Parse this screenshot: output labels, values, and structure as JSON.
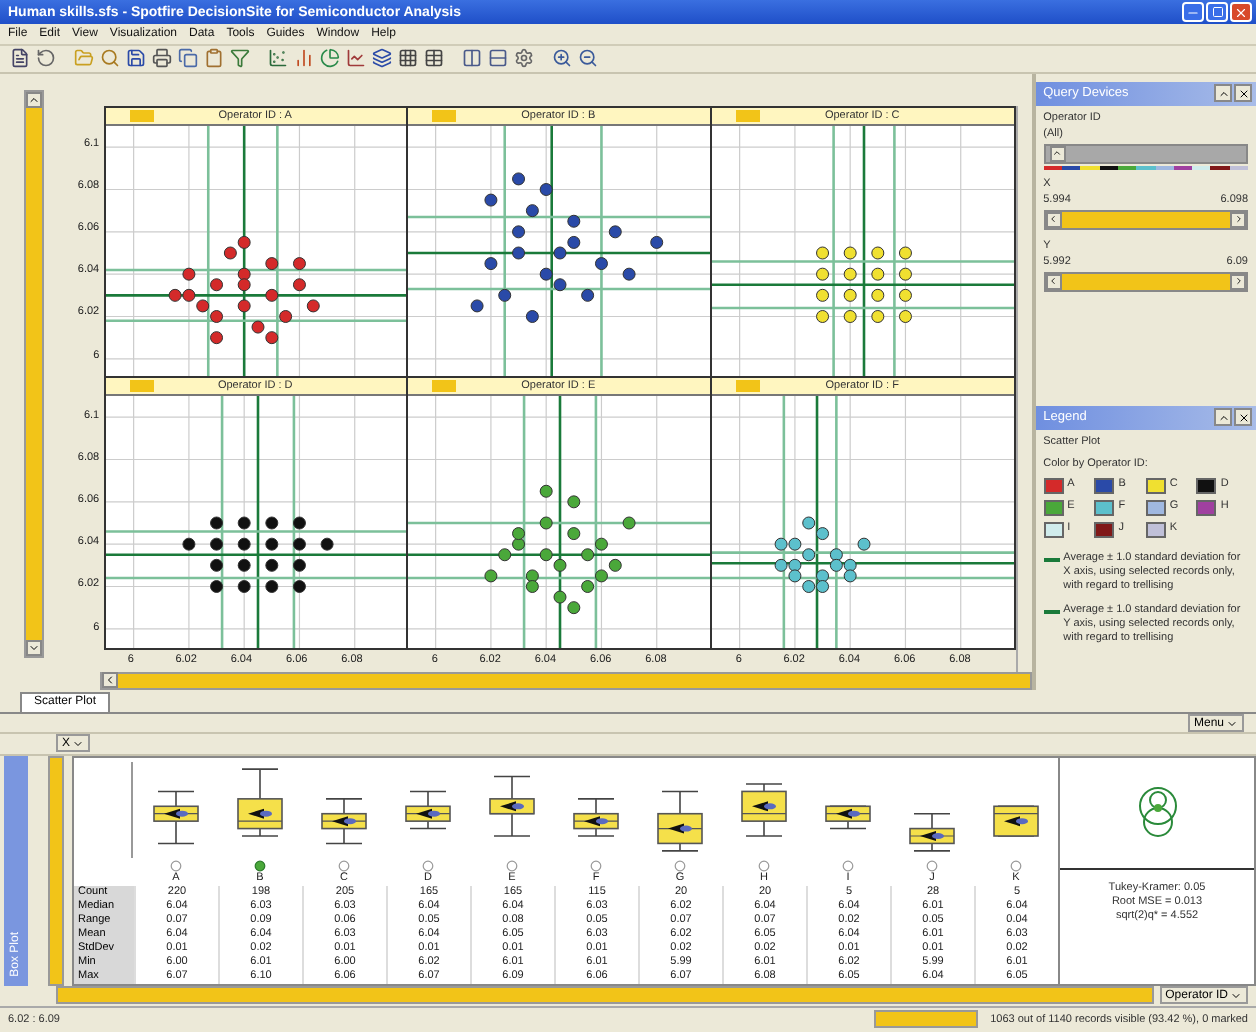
{
  "window": {
    "title": "Human skills.sfs - Spotfire DecisionSite for Semiconductor Analysis"
  },
  "menu": [
    "File",
    "Edit",
    "View",
    "Visualization",
    "Data",
    "Tools",
    "Guides",
    "Window",
    "Help"
  ],
  "scatter": {
    "panels": [
      {
        "chart_data": {
          "type": "scatter",
          "grid": true,
          "title": "Operator ID : A",
          "ref_lines": [
            {
              "axis": "x",
              "color": "#1a7a3a",
              "value": 6.04
            },
            {
              "axis": "x",
              "color": "#7cc09a",
              "value": 6.027
            },
            {
              "axis": "x",
              "color": "#7cc09a",
              "value": 6.052
            },
            {
              "axis": "y",
              "color": "#1a7a3a",
              "value": 6.03
            },
            {
              "axis": "y",
              "color": "#7cc09a",
              "value": 6.018
            },
            {
              "axis": "y",
              "color": "#7cc09a",
              "value": 6.042
            }
          ],
          "x": [
            6.02,
            6.03,
            6.04,
            6.05,
            6.06,
            6.03,
            6.04,
            6.05,
            6.02,
            6.035,
            6.045,
            6.055,
            6.025,
            6.04,
            6.06,
            6.015,
            6.05,
            6.03,
            6.065,
            6.04
          ],
          "series": [
            {
              "color": "#d42a2a",
              "values": [
                6.03,
                6.035,
                6.04,
                6.03,
                6.035,
                6.02,
                6.025,
                6.045,
                6.04,
                6.05,
                6.015,
                6.02,
                6.025,
                6.055,
                6.045,
                6.03,
                6.01,
                6.01,
                6.025,
                6.035
              ]
            }
          ],
          "xlim": [
            5.99,
            6.1
          ],
          "ylim": [
            5.99,
            6.11
          ],
          "yticks": [
            6,
            6.02,
            6.04,
            6.06,
            6.08,
            6.1
          ]
        }
      },
      {
        "chart_data": {
          "type": "scatter",
          "grid": true,
          "title": "Operator ID : B",
          "ref_lines": [
            {
              "axis": "x",
              "color": "#1a7a3a",
              "value": 6.042
            },
            {
              "axis": "x",
              "color": "#7cc09a",
              "value": 6.025
            },
            {
              "axis": "x",
              "color": "#7cc09a",
              "value": 6.06
            },
            {
              "axis": "y",
              "color": "#1a7a3a",
              "value": 6.05
            },
            {
              "axis": "y",
              "color": "#7cc09a",
              "value": 6.033
            },
            {
              "axis": "y",
              "color": "#7cc09a",
              "value": 6.067
            }
          ],
          "x": [
            6.02,
            6.03,
            6.04,
            6.05,
            6.06,
            6.03,
            6.035,
            6.045,
            6.025,
            6.055,
            6.04,
            6.07,
            6.015,
            6.05,
            6.03,
            6.065,
            6.045,
            6.035,
            6.08,
            6.02
          ],
          "series": [
            {
              "color": "#2a4aa8",
              "values": [
                6.045,
                6.05,
                6.04,
                6.055,
                6.045,
                6.06,
                6.07,
                6.035,
                6.03,
                6.03,
                6.08,
                6.04,
                6.025,
                6.065,
                6.085,
                6.06,
                6.05,
                6.02,
                6.055,
                6.075
              ]
            }
          ],
          "xlim": [
            5.99,
            6.1
          ],
          "ylim": [
            5.99,
            6.11
          ]
        }
      },
      {
        "chart_data": {
          "type": "scatter",
          "grid": true,
          "title": "Operator ID : C",
          "ref_lines": [
            {
              "axis": "x",
              "color": "#1a7a3a",
              "value": 6.045
            },
            {
              "axis": "x",
              "color": "#7cc09a",
              "value": 6.034
            },
            {
              "axis": "x",
              "color": "#7cc09a",
              "value": 6.056
            },
            {
              "axis": "y",
              "color": "#1a7a3a",
              "value": 6.035
            },
            {
              "axis": "y",
              "color": "#7cc09a",
              "value": 6.024
            },
            {
              "axis": "y",
              "color": "#7cc09a",
              "value": 6.046
            }
          ],
          "x": [
            6.03,
            6.04,
            6.05,
            6.06,
            6.03,
            6.04,
            6.05,
            6.06,
            6.03,
            6.04,
            6.05,
            6.06,
            6.03,
            6.04,
            6.05,
            6.06
          ],
          "series": [
            {
              "color": "#f0e030",
              "values": [
                6.05,
                6.05,
                6.05,
                6.05,
                6.04,
                6.04,
                6.04,
                6.04,
                6.03,
                6.03,
                6.03,
                6.03,
                6.02,
                6.02,
                6.02,
                6.02
              ]
            }
          ],
          "xlim": [
            5.99,
            6.1
          ],
          "ylim": [
            5.99,
            6.11
          ]
        }
      },
      {
        "chart_data": {
          "type": "scatter",
          "grid": true,
          "title": "Operator ID : D",
          "ref_lines": [
            {
              "axis": "x",
              "color": "#1a7a3a",
              "value": 6.045
            },
            {
              "axis": "x",
              "color": "#7cc09a",
              "value": 6.032
            },
            {
              "axis": "x",
              "color": "#7cc09a",
              "value": 6.058
            },
            {
              "axis": "y",
              "color": "#1a7a3a",
              "value": 6.035
            },
            {
              "axis": "y",
              "color": "#7cc09a",
              "value": 6.024
            },
            {
              "axis": "y",
              "color": "#7cc09a",
              "value": 6.046
            }
          ],
          "x": [
            6.03,
            6.04,
            6.05,
            6.06,
            6.02,
            6.03,
            6.04,
            6.05,
            6.06,
            6.07,
            6.03,
            6.04,
            6.05,
            6.06,
            6.03,
            6.04,
            6.05,
            6.06
          ],
          "series": [
            {
              "color": "#111111",
              "values": [
                6.05,
                6.05,
                6.05,
                6.05,
                6.04,
                6.04,
                6.04,
                6.04,
                6.04,
                6.04,
                6.03,
                6.03,
                6.03,
                6.03,
                6.02,
                6.02,
                6.02,
                6.02
              ]
            }
          ],
          "xlim": [
            5.99,
            6.1
          ],
          "ylim": [
            5.99,
            6.11
          ],
          "xticks": [
            6,
            6.02,
            6.04,
            6.06,
            6.08
          ],
          "yticks": [
            6,
            6.02,
            6.04,
            6.06,
            6.08,
            6.1
          ]
        }
      },
      {
        "chart_data": {
          "type": "scatter",
          "grid": true,
          "title": "Operator ID : E",
          "ref_lines": [
            {
              "axis": "x",
              "color": "#1a7a3a",
              "value": 6.045
            },
            {
              "axis": "x",
              "color": "#7cc09a",
              "value": 6.032
            },
            {
              "axis": "x",
              "color": "#7cc09a",
              "value": 6.058
            },
            {
              "axis": "y",
              "color": "#1a7a3a",
              "value": 6.035
            },
            {
              "axis": "y",
              "color": "#7cc09a",
              "value": 6.024
            },
            {
              "axis": "y",
              "color": "#7cc09a",
              "value": 6.05
            }
          ],
          "x": [
            6.03,
            6.04,
            6.05,
            6.045,
            6.035,
            6.055,
            6.06,
            6.025,
            6.04,
            6.05,
            6.065,
            6.02,
            6.045,
            6.03,
            6.055,
            6.07,
            6.04,
            6.035,
            6.05,
            6.06
          ],
          "series": [
            {
              "color": "#4aa83a",
              "values": [
                6.04,
                6.035,
                6.045,
                6.03,
                6.025,
                6.02,
                6.04,
                6.035,
                6.05,
                6.06,
                6.03,
                6.025,
                6.015,
                6.045,
                6.035,
                6.05,
                6.065,
                6.02,
                6.01,
                6.025
              ]
            }
          ],
          "xlim": [
            5.99,
            6.1
          ],
          "ylim": [
            5.99,
            6.11
          ],
          "xticks": [
            6,
            6.02,
            6.04,
            6.06,
            6.08
          ]
        }
      },
      {
        "chart_data": {
          "type": "scatter",
          "grid": true,
          "title": "Operator ID : F",
          "ref_lines": [
            {
              "axis": "x",
              "color": "#1a7a3a",
              "value": 6.028
            },
            {
              "axis": "x",
              "color": "#7cc09a",
              "value": 6.016
            },
            {
              "axis": "x",
              "color": "#7cc09a",
              "value": 6.035
            },
            {
              "axis": "y",
              "color": "#1a7a3a",
              "value": 6.031
            },
            {
              "axis": "y",
              "color": "#7cc09a",
              "value": 6.024
            },
            {
              "axis": "y",
              "color": "#7cc09a",
              "value": 6.036
            }
          ],
          "x": [
            6.02,
            6.025,
            6.03,
            6.015,
            6.035,
            6.02,
            6.03,
            6.025,
            6.04,
            6.045,
            6.02,
            6.03,
            6.035,
            6.025,
            6.015,
            6.04
          ],
          "series": [
            {
              "color": "#5cc0cc",
              "values": [
                6.03,
                6.035,
                6.025,
                6.03,
                6.035,
                6.04,
                6.045,
                6.02,
                6.03,
                6.04,
                6.025,
                6.02,
                6.03,
                6.05,
                6.04,
                6.025
              ]
            }
          ],
          "xlim": [
            5.99,
            6.1
          ],
          "ylim": [
            5.99,
            6.11
          ],
          "xticks": [
            6,
            6.02,
            6.04,
            6.06,
            6.08
          ]
        }
      }
    ]
  },
  "tab": {
    "label": "Scatter Plot",
    "selected": true
  },
  "query_devices": {
    "title": "Query Devices",
    "filters": [
      {
        "kind": "list",
        "label": "Operator ID",
        "value": "(All)"
      },
      {
        "kind": "range",
        "label": "X",
        "min": "5.994",
        "max": "6.098",
        "level": 1
      },
      {
        "kind": "range",
        "label": "Y",
        "min": "5.992",
        "max": "6.09",
        "level": 1
      }
    ]
  },
  "legend": {
    "title": "Legend",
    "subtitle": "Scatter Plot",
    "color_by": "Color by Operator ID:",
    "items": [
      {
        "label": "A",
        "color": "#d42a2a"
      },
      {
        "label": "B",
        "color": "#2a4aa8"
      },
      {
        "label": "C",
        "color": "#f0e030"
      },
      {
        "label": "D",
        "color": "#111111"
      },
      {
        "label": "E",
        "color": "#4aa83a"
      },
      {
        "label": "F",
        "color": "#5cc0cc"
      },
      {
        "label": "G",
        "color": "#a0b8e0"
      },
      {
        "label": "H",
        "color": "#a040a0"
      },
      {
        "label": "I",
        "color": "#d0ecec"
      },
      {
        "label": "J",
        "color": "#801818"
      },
      {
        "label": "K",
        "color": "#c0c0d8"
      }
    ],
    "notes": [
      "Average ± 1.0 standard deviation for X axis, using selected records only, with regard to trellising",
      "Average ± 1.0 standard deviation for Y axis, using selected records only, with regard to trellising"
    ]
  },
  "box_plot": {
    "menu": "Menu",
    "x_selector": "X",
    "side_label": "Box Plot",
    "group_selector": "Operator ID",
    "categories": [
      {
        "label": "A",
        "selected": false
      },
      {
        "label": "B",
        "selected": true
      },
      {
        "label": "C",
        "selected": false
      },
      {
        "label": "D",
        "selected": false
      },
      {
        "label": "E",
        "selected": false
      },
      {
        "label": "F",
        "selected": false
      },
      {
        "label": "G",
        "selected": false
      },
      {
        "label": "H",
        "selected": false
      },
      {
        "label": "I",
        "selected": false
      },
      {
        "label": "J",
        "selected": false
      },
      {
        "label": "K",
        "selected": false
      }
    ],
    "stats": [
      {
        "label": "Count",
        "values": [
          "220",
          "198",
          "205",
          "165",
          "165",
          "115",
          "20",
          "20",
          "5",
          "28",
          "5"
        ]
      },
      {
        "label": "Median",
        "values": [
          "6.04",
          "6.03",
          "6.03",
          "6.04",
          "6.04",
          "6.03",
          "6.02",
          "6.04",
          "6.04",
          "6.01",
          "6.04"
        ]
      },
      {
        "label": "Range",
        "values": [
          "0.07",
          "0.09",
          "0.06",
          "0.05",
          "0.08",
          "0.05",
          "0.07",
          "0.07",
          "0.02",
          "0.05",
          "0.04"
        ]
      },
      {
        "label": "Mean",
        "values": [
          "6.04",
          "6.04",
          "6.03",
          "6.04",
          "6.05",
          "6.03",
          "6.02",
          "6.05",
          "6.04",
          "6.01",
          "6.03"
        ]
      },
      {
        "label": "StdDev",
        "values": [
          "0.01",
          "0.02",
          "0.01",
          "0.01",
          "0.01",
          "0.01",
          "0.02",
          "0.02",
          "0.01",
          "0.01",
          "0.02"
        ]
      },
      {
        "label": "Min",
        "values": [
          "6.00",
          "6.01",
          "6.00",
          "6.02",
          "6.01",
          "6.01",
          "5.99",
          "6.01",
          "6.02",
          "5.99",
          "6.01"
        ]
      },
      {
        "label": "Max",
        "values": [
          "6.07",
          "6.10",
          "6.06",
          "6.07",
          "6.09",
          "6.06",
          "6.07",
          "6.08",
          "6.05",
          "6.04",
          "6.05"
        ]
      }
    ],
    "comparison": [
      "Tukey-Kramer: 0.05",
      "Root MSE = 0.013",
      "sqrt(2)q* = 4.552"
    ]
  },
  "status": {
    "coords": "6.02 : 6.09",
    "records": "1063 out of 1140 records visible (93.42 %), 0 marked"
  }
}
